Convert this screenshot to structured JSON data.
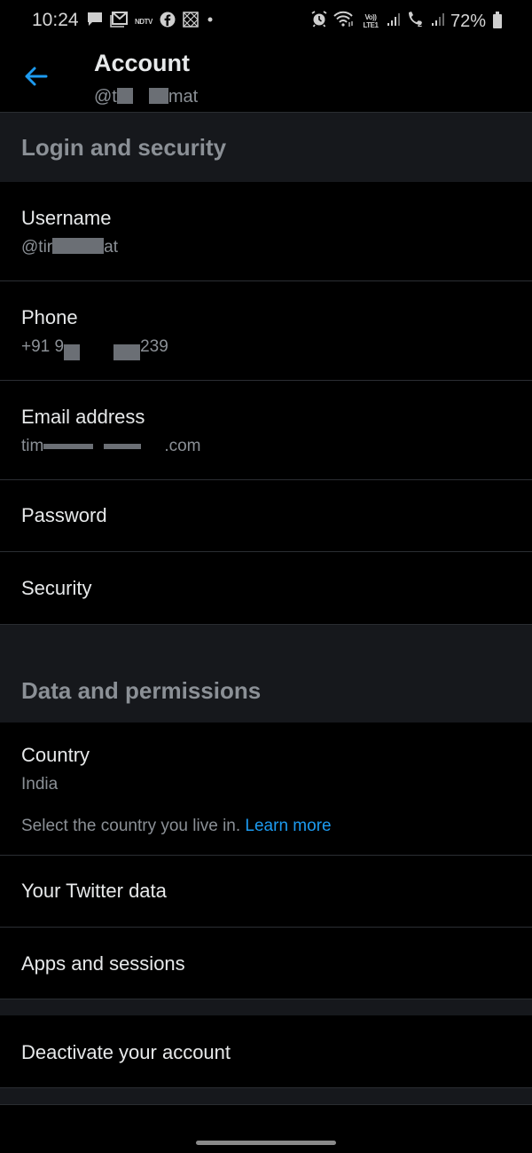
{
  "status_bar": {
    "time": "10:24",
    "left_icons": [
      "message-icon",
      "gmail-icon",
      "ndtv-icon",
      "facebook-icon",
      "app-icon",
      "dot-icon"
    ],
    "ndtv_label": "NDTV",
    "volte_label": "Vo)) LTE1",
    "sim2_label": "2",
    "battery": "72%"
  },
  "header": {
    "title": "Account",
    "handle_prefix": "@t",
    "handle_suffix": "mat"
  },
  "sections": {
    "login_security": {
      "label": "Login and security",
      "items": {
        "username": {
          "title": "Username",
          "value_prefix": "@tir",
          "value_suffix": "at"
        },
        "phone": {
          "title": "Phone",
          "value_prefix": "+91 9",
          "value_suffix": "239"
        },
        "email": {
          "title": "Email address",
          "value_prefix": "tim",
          "value_suffix": ".com"
        },
        "password": {
          "title": "Password"
        },
        "security": {
          "title": "Security"
        }
      }
    },
    "data_permissions": {
      "label": "Data and permissions",
      "items": {
        "country": {
          "title": "Country",
          "value": "India",
          "description": "Select the country you live in.",
          "link": "Learn more"
        },
        "twitter_data": {
          "title": "Your Twitter data"
        },
        "apps_sessions": {
          "title": "Apps and sessions"
        }
      }
    },
    "deactivate": {
      "title": "Deactivate your account"
    }
  },
  "colors": {
    "accent": "#1d9bf0",
    "background": "#000000",
    "section_bg": "#16181c",
    "secondary_text": "#8b9096"
  }
}
